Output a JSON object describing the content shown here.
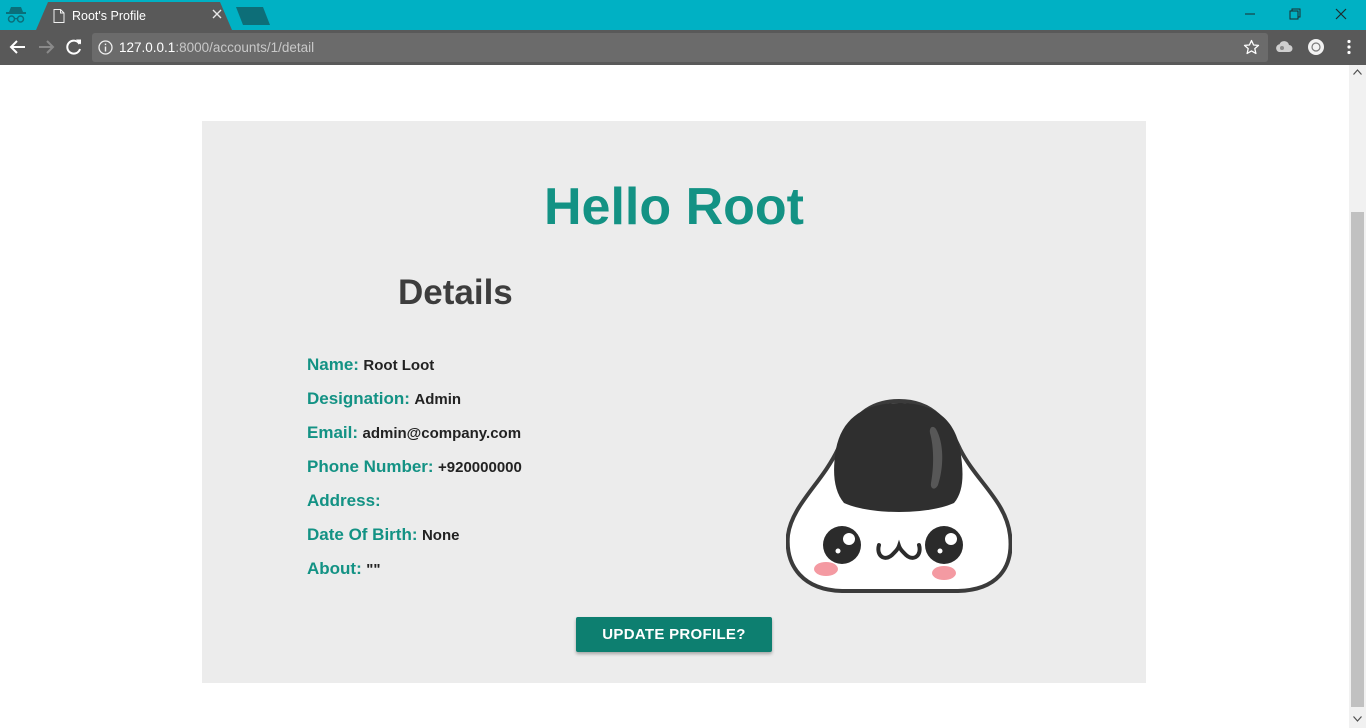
{
  "browser": {
    "tab_title": "Root's Profile",
    "url_host": "127.0.0.1",
    "url_path": ":8000/accounts/1/detail",
    "icons": {
      "incognito": "incognito-icon",
      "page": "page-icon",
      "close": "close-icon",
      "back": "back-arrow-icon",
      "forward": "forward-arrow-icon",
      "reload": "reload-icon",
      "info": "info-icon",
      "bookmark": "star-icon",
      "menu": "kebab-menu-icon"
    },
    "colors": {
      "tabbar": "#00b1c4",
      "toolbar": "#595959"
    }
  },
  "page": {
    "greeting": "Hello Root",
    "details_heading": "Details",
    "fields": [
      {
        "label": "Name:",
        "value": "Root Loot"
      },
      {
        "label": "Designation:",
        "value": "Admin"
      },
      {
        "label": "Email:",
        "value": "admin@company.com"
      },
      {
        "label": "Phone Number:",
        "value": "+920000000"
      },
      {
        "label": "Address:",
        "value": ""
      },
      {
        "label": "Date Of Birth:",
        "value": "None"
      },
      {
        "label": "About:",
        "value": "\"\""
      }
    ],
    "avatar": "onigiri-avatar",
    "update_button": "UPDATE PROFILE?",
    "colors": {
      "accent": "#139284",
      "button": "#0d7f70",
      "card": "#ececec"
    }
  }
}
